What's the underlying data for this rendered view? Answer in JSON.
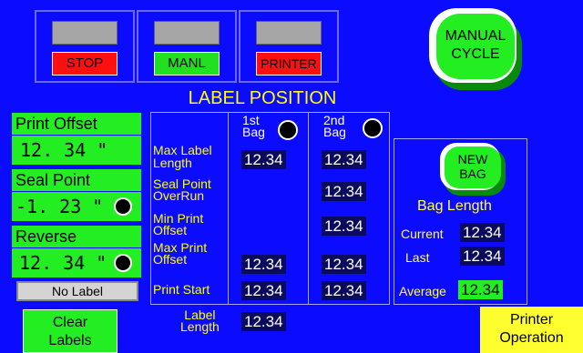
{
  "colors": {
    "background": "#0b0bff",
    "accent_green": "#22ee22",
    "alarm_red": "#ff1010",
    "label_yellow": "#ffff00"
  },
  "buttons": {
    "stop": "STOP",
    "manl": "MANL",
    "printer": "PRINTER",
    "manual_cycle_line1": "MANUAL",
    "manual_cycle_line2": "CYCLE",
    "new_bag_line1": "NEW",
    "new_bag_line2": "BAG"
  },
  "title": "LABEL POSITION",
  "left": {
    "print_offset": {
      "label": "Print Offset",
      "value": "12. 34  \""
    },
    "seal_point": {
      "label": "Seal Point",
      "value": "-1. 23  \""
    },
    "reverse": {
      "label": "Reverse",
      "value": "12. 34 \""
    },
    "no_label": "No Label",
    "clear_labels_line1": "Clear",
    "clear_labels_line2": "Labels"
  },
  "table": {
    "col1_line1": "1st",
    "col1_line2": "Bag",
    "col2_line1": "2nd",
    "col2_line2": "Bag",
    "rows": [
      {
        "l1": "Max Label",
        "l2": "Length",
        "c1": "12.34",
        "c2": "12.34"
      },
      {
        "l1": "Seal Point",
        "l2": "OverRun",
        "c1": "",
        "c2": "12.34"
      },
      {
        "l1": "Min Print",
        "l2": "Offset",
        "c1": "",
        "c2": "12.34"
      },
      {
        "l1": "Max Print",
        "l2": "Offset",
        "c1": "12.34",
        "c2": "12.34"
      },
      {
        "l1": "Print Start",
        "l2": "",
        "c1": "12.34",
        "c2": "12.34"
      }
    ],
    "label_length": {
      "l1": "Label",
      "l2": "Length",
      "value": "12.34"
    }
  },
  "bag": {
    "title": "Bag Length",
    "current_label": "Current",
    "current": "12.34",
    "last_label": "Last",
    "last": "12.34",
    "average_label": "Average",
    "average": "12.34"
  },
  "printer_operation_line1": "Printer",
  "printer_operation_line2": "Operation"
}
